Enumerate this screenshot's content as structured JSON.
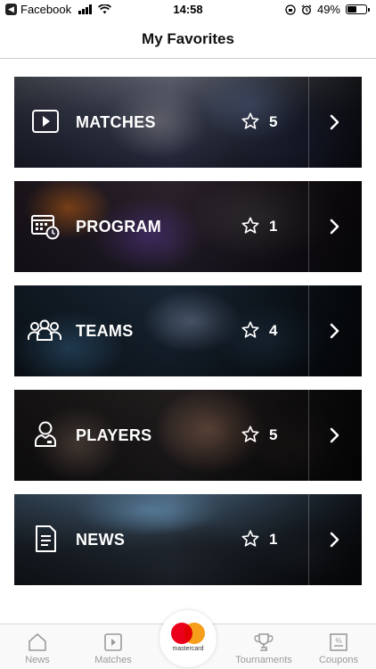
{
  "status_bar": {
    "back_app": "Facebook",
    "time": "14:58",
    "battery": "49%",
    "battery_level": 0.49
  },
  "header": {
    "title": "My Favorites"
  },
  "cards": [
    {
      "label": "MATCHES",
      "count": "5",
      "icon": "play-icon"
    },
    {
      "label": "PROGRAM",
      "count": "1",
      "icon": "calendar-clock-icon"
    },
    {
      "label": "TEAMS",
      "count": "4",
      "icon": "team-icon"
    },
    {
      "label": "PLAYERS",
      "count": "5",
      "icon": "player-icon"
    },
    {
      "label": "NEWS",
      "count": "1",
      "icon": "document-icon"
    }
  ],
  "tabbar": {
    "news": "News",
    "matches": "Matches",
    "sponsor": "mastercard",
    "tournaments": "Tournaments",
    "coupons": "Coupons"
  },
  "colors": {
    "accent_red": "#eb001b",
    "accent_orange": "#f79e1b",
    "tab_inactive": "#9a9a9a"
  }
}
